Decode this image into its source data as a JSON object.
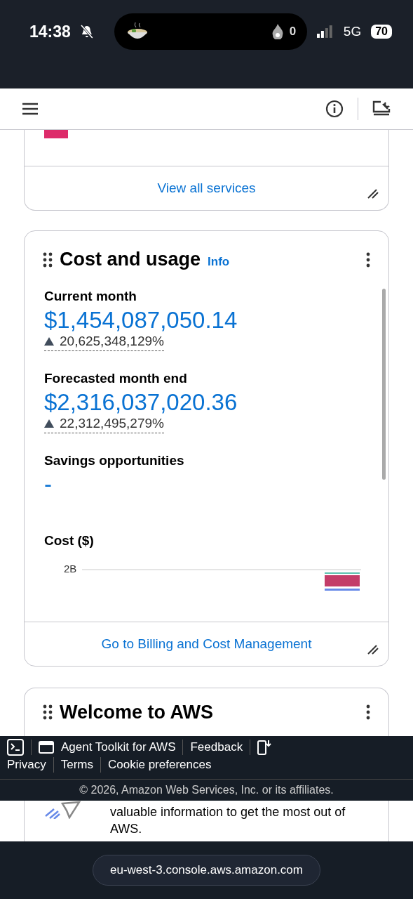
{
  "status_bar": {
    "time": "14:38",
    "activity_count": "0",
    "network": "5G",
    "battery": "70"
  },
  "services_card": {
    "link": "View all services"
  },
  "cost_card": {
    "title": "Cost and usage",
    "info": "Info",
    "metrics": [
      {
        "label": "Current month",
        "value": "$1,454,087,050.14",
        "change": "20,625,348,129%",
        "increased": true
      },
      {
        "label": "Forecasted month end",
        "value": "$2,316,037,020.36",
        "change": "22,312,495,279%",
        "increased": true
      },
      {
        "label": "Savings opportunities",
        "value": "-"
      }
    ],
    "chart_title": "Cost ($)",
    "chart_tick": "2B",
    "link": "Go to Billing and Cost Management"
  },
  "welcome_card": {
    "title": "Welcome to AWS",
    "text": "valuable information to get the most out of AWS."
  },
  "footer": {
    "links": [
      "Agent Toolkit for AWS",
      "Feedback"
    ],
    "legal": [
      "Privacy",
      "Terms",
      "Cookie preferences"
    ],
    "copyright": "© 2026, Amazon Web Services, Inc. or its affiliates."
  },
  "browser": {
    "url": "eu-west-3.console.aws.amazon.com"
  }
}
